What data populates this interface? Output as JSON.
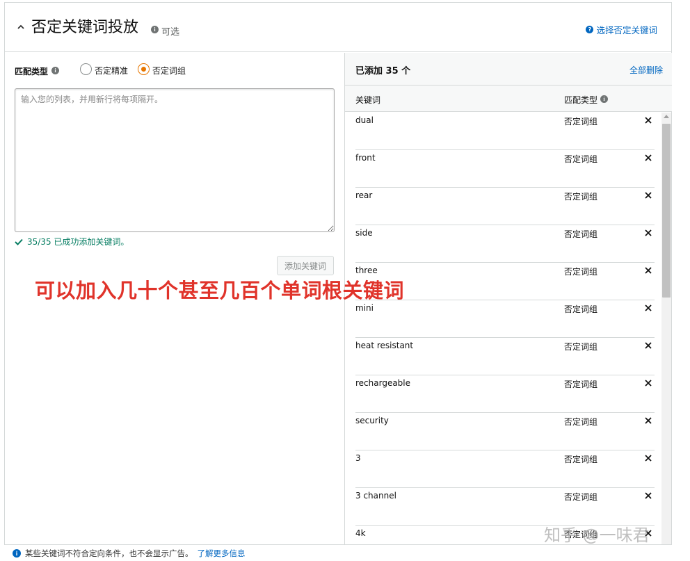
{
  "header": {
    "title": "否定关键词投放",
    "optional_label": "可选",
    "help_link": "选择否定关键词"
  },
  "left": {
    "match_type_label": "匹配类型",
    "radio_exact": "否定精准",
    "radio_phrase": "否定词组",
    "selected": "否定词组",
    "textarea_placeholder": "输入您的列表，并用新行将每项隔开。",
    "textarea_value": "",
    "success_message": "35/35 已成功添加关键词。",
    "add_button": "添加关键词"
  },
  "annotation": "可以加入几十个甚至几百个单词根关键词",
  "right": {
    "added_count": "已添加 35 个",
    "remove_all": "全部删除",
    "col_keyword": "关键词",
    "col_match_type": "匹配类型",
    "rows": [
      {
        "keyword": "dual",
        "match_type": "否定词组"
      },
      {
        "keyword": "front",
        "match_type": "否定词组"
      },
      {
        "keyword": "rear",
        "match_type": "否定词组"
      },
      {
        "keyword": "side",
        "match_type": "否定词组"
      },
      {
        "keyword": "three",
        "match_type": "否定词组"
      },
      {
        "keyword": "mini",
        "match_type": "否定词组"
      },
      {
        "keyword": "heat resistant",
        "match_type": "否定词组"
      },
      {
        "keyword": "rechargeable",
        "match_type": "否定词组"
      },
      {
        "keyword": "security",
        "match_type": "否定词组"
      },
      {
        "keyword": "3",
        "match_type": "否定词组"
      },
      {
        "keyword": "3 channel",
        "match_type": "否定词组"
      },
      {
        "keyword": "4k",
        "match_type": "否定词组"
      }
    ]
  },
  "footer": {
    "notice": "某些关键词不符合定向条件，也不会显示广告。",
    "learn_more": "了解更多信息"
  },
  "watermark": "知乎 @一味君",
  "colors": {
    "link": "#0066c0",
    "radio_selected": "#e77600",
    "success": "#067d62",
    "annotation": "#e0332a"
  }
}
